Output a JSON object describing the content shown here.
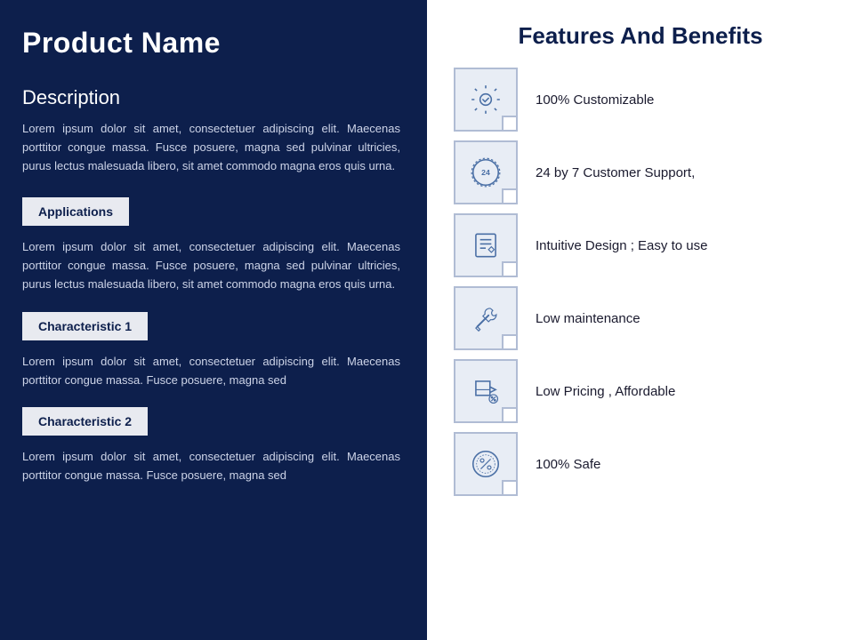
{
  "left": {
    "product_title": "Product Name",
    "description_heading": "Description",
    "description_text": "Lorem ipsum dolor sit amet, consectetuer  adipiscing elit. Maecenas porttitor congue massa. Fusce posuere, magna sed pulvinar ultricies,  purus lectus malesuada libero, sit amet commodo  magna eros quis urna.",
    "applications_label": "Applications",
    "applications_text": "Lorem ipsum dolor sit amet, consectetuer  adipiscing elit. Maecenas porttitor congue massa. Fusce posuere, magna sed pulvinar ultricies,  purus lectus malesuada libero, sit amet commodo  magna eros quis urna.",
    "characteristic1_label": "Characteristic  1",
    "characteristic1_text": "Lorem ipsum dolor sit amet, consectetuer  adipiscing elit. Maecenas porttitor congue massa. Fusce posuere, magna sed",
    "characteristic2_label": "Characteristic  2",
    "characteristic2_text": "Lorem ipsum dolor sit amet, consectetuer  adipiscing elit. Maecenas porttitor congue massa. Fusce posuere, magna sed"
  },
  "right": {
    "features_title": "Features And Benefits",
    "features": [
      {
        "label": "100% Customizable",
        "icon": "gear-check"
      },
      {
        "label": "24 by 7 Customer Support,",
        "icon": "clock-24"
      },
      {
        "label": "Intuitive Design ; Easy to use",
        "icon": "design-pencil"
      },
      {
        "label": "Low maintenance",
        "icon": "wrench-screwdriver"
      },
      {
        "label": "Low Pricing , Affordable",
        "icon": "box-tag"
      },
      {
        "label": "100% Safe",
        "icon": "percent-circle"
      }
    ]
  }
}
